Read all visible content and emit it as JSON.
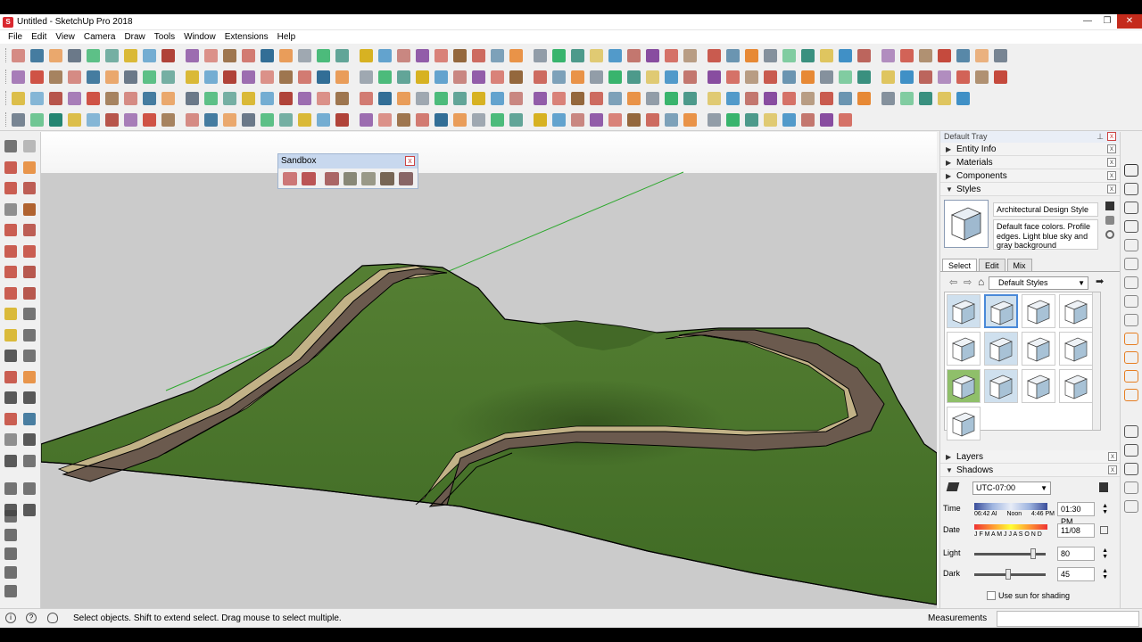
{
  "window": {
    "title": "Untitled - SketchUp Pro 2018"
  },
  "menu": [
    "File",
    "Edit",
    "View",
    "Camera",
    "Draw",
    "Tools",
    "Window",
    "Extensions",
    "Help"
  ],
  "sandbox": {
    "title": "Sandbox"
  },
  "tray": {
    "title": "Default Tray",
    "sections": {
      "entity_info": "Entity Info",
      "materials": "Materials",
      "components": "Components",
      "styles": "Styles",
      "layers": "Layers",
      "shadows": "Shadows"
    },
    "style": {
      "name": "Architectural Design Style",
      "description": "Default face colors. Profile edges. Light blue sky and gray background"
    },
    "tabs": [
      "Select",
      "Edit",
      "Mix"
    ],
    "library": "Default Styles",
    "shadow": {
      "timezone": "UTC-07:00",
      "time_label": "Time",
      "time_ticks": [
        "06:42 AI",
        "Noon",
        "4:46 PM"
      ],
      "time_value": "01:30 PM",
      "date_label": "Date",
      "months": "J F M A M J J A S O N D",
      "date_value": "11/08",
      "light_label": "Light",
      "light_value": "80",
      "dark_label": "Dark",
      "dark_value": "45",
      "use_sun": "Use sun for shading",
      "light_level": 0.85,
      "dark_level": 0.47
    }
  },
  "status": {
    "message": "Select objects. Shift to extend select. Drag mouse to select multiple.",
    "measurements": "Measurements"
  },
  "colors": {
    "terrain": "#4f7a2e",
    "road": "#6b5a4e",
    "shoulder": "#c8b98c",
    "sky": "#ffffff",
    "ground": "#cccccc",
    "axis_green": "#2ca82c"
  }
}
